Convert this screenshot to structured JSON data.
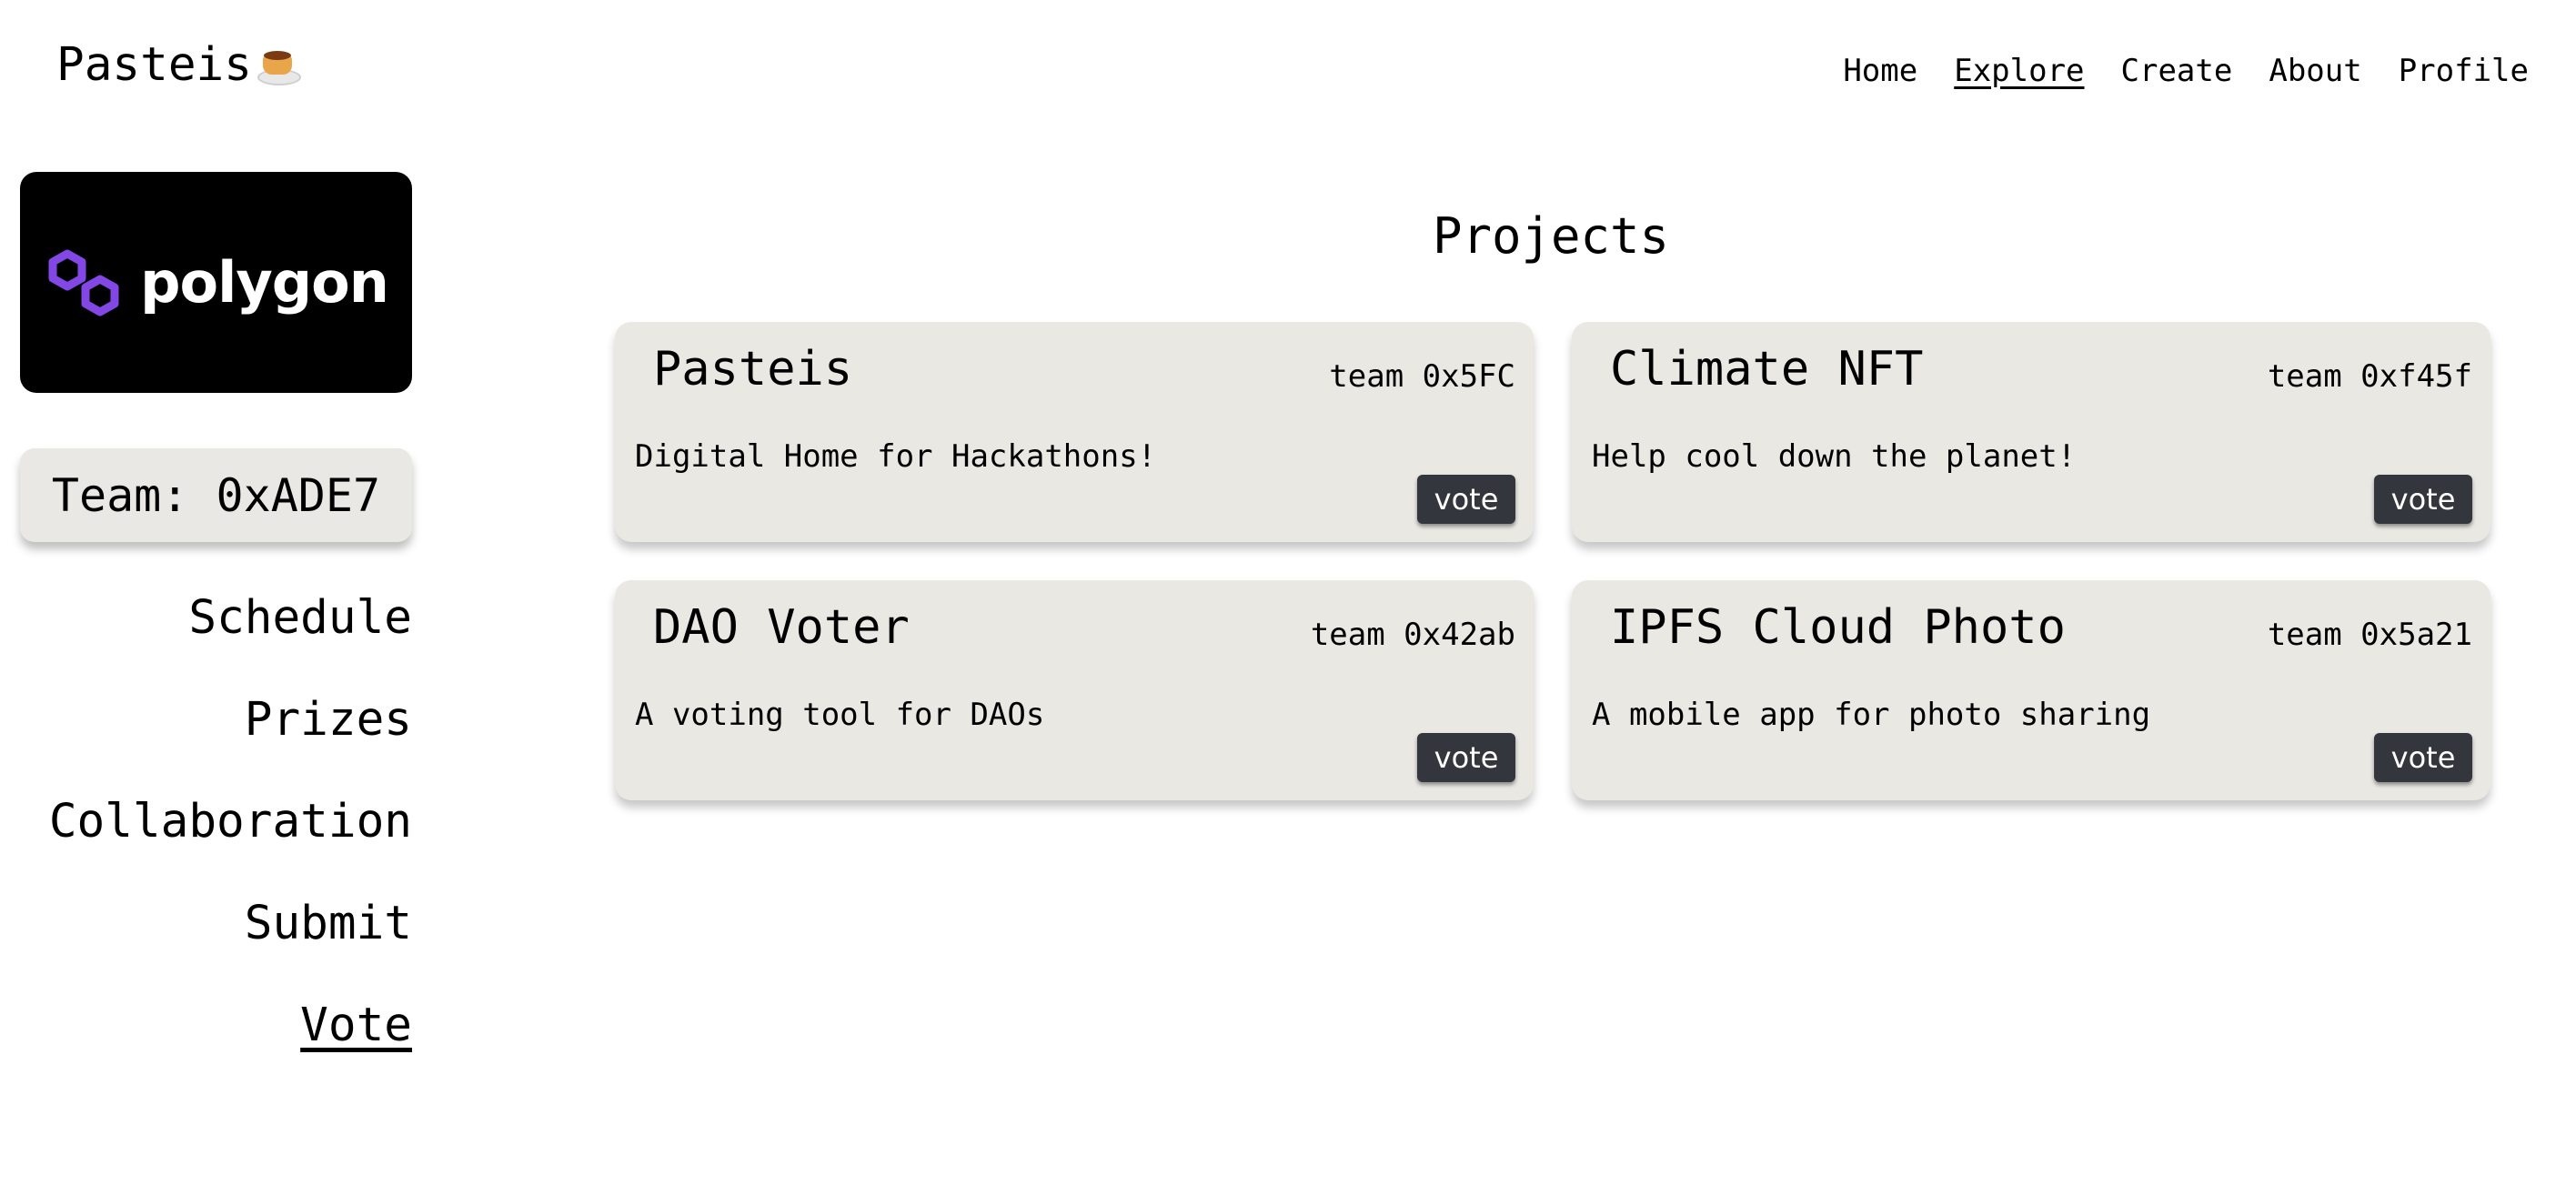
{
  "brand": {
    "name": "Pasteis",
    "emoji_icon": "flan-icon"
  },
  "nav": {
    "items": [
      {
        "label": "Home",
        "active": false
      },
      {
        "label": "Explore",
        "active": true
      },
      {
        "label": "Create",
        "active": false
      },
      {
        "label": "About",
        "active": false
      },
      {
        "label": "Profile",
        "active": false
      }
    ]
  },
  "sponsor": {
    "name": "polygon",
    "color": "#8247e5"
  },
  "team": {
    "label": "Team: 0xADE7"
  },
  "sidebar": {
    "items": [
      {
        "label": "Schedule",
        "active": false
      },
      {
        "label": "Prizes",
        "active": false
      },
      {
        "label": "Collaboration",
        "active": false
      },
      {
        "label": "Submit",
        "active": false
      },
      {
        "label": "Vote",
        "active": true
      }
    ]
  },
  "main": {
    "title": "Projects",
    "projects": [
      {
        "title": "Pasteis",
        "team": "team 0x5FC",
        "description": "Digital Home for Hackathons!",
        "vote_label": "vote"
      },
      {
        "title": "Climate NFT",
        "team": "team 0xf45f",
        "description": "Help cool down the planet!",
        "vote_label": "vote"
      },
      {
        "title": "DAO Voter",
        "team": "team 0x42ab",
        "description": "A voting tool for DAOs",
        "vote_label": "vote"
      },
      {
        "title": "IPFS Cloud Photo",
        "team": "team 0x5a21",
        "description": "A mobile app for photo sharing",
        "vote_label": "vote"
      }
    ]
  }
}
